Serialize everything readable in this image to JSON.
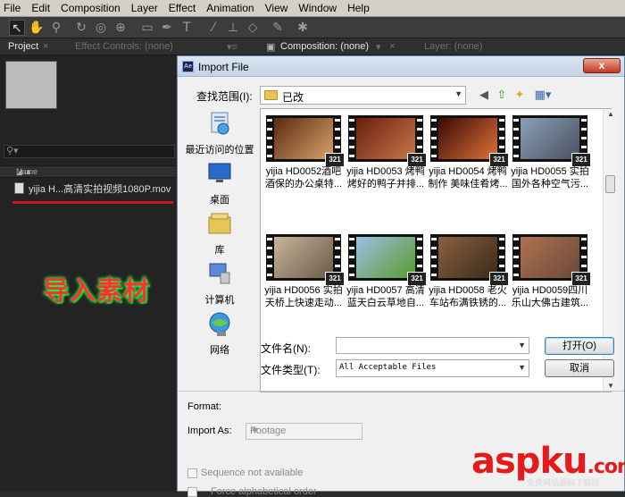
{
  "menubar": [
    "File",
    "Edit",
    "Composition",
    "Layer",
    "Effect",
    "Animation",
    "View",
    "Window",
    "Help"
  ],
  "panels": {
    "project_tab": "Project",
    "effect_controls_tab": "Effect Controls: (none)",
    "composition_tab": "Composition: (none)",
    "layer_tab": "Layer: (none)"
  },
  "project": {
    "search_placeholder": "",
    "column_name": "Name",
    "items": [
      {
        "name": "yijia H...高清实拍视频1080P.mov"
      }
    ]
  },
  "annotation": "导入素材",
  "dialog": {
    "title": "Import File",
    "close_label": "x",
    "look_in_label": "查找范围(I):",
    "look_in_value": "已改",
    "places": [
      {
        "label": "最近访问的位置",
        "icon": "recent-places-icon"
      },
      {
        "label": "桌面",
        "icon": "desktop-icon"
      },
      {
        "label": "库",
        "icon": "libraries-icon"
      },
      {
        "label": "计算机",
        "icon": "computer-icon"
      },
      {
        "label": "网络",
        "icon": "network-icon"
      }
    ],
    "files": [
      {
        "caption": "yijia HD0052酒吧酒保的办公桌特...",
        "badge": "321",
        "colors": [
          "#5a2a10",
          "#d9a36a"
        ]
      },
      {
        "caption": "yijia HD0053 烤鸭烤好的鸭子并排...",
        "badge": "321",
        "colors": [
          "#6a1e0e",
          "#c8784a"
        ]
      },
      {
        "caption": "yijia HD0054 烤鸭制作 美味佳肴烤...",
        "badge": "321",
        "colors": [
          "#3a0a04",
          "#e0703a"
        ]
      },
      {
        "caption": "yijia HD0055 实拍国外各种空气污...",
        "badge": "321",
        "colors": [
          "#8aa0b8",
          "#4a5060"
        ]
      },
      {
        "caption": "yijia HD0056 实拍天桥上快速走动...",
        "badge": "321",
        "colors": [
          "#c8b49a",
          "#6a5a48"
        ]
      },
      {
        "caption": "yijia HD0057 高清蓝天白云草地自...",
        "badge": "321",
        "colors": [
          "#9ac0e8",
          "#5a9a2a"
        ]
      },
      {
        "caption": "yijia HD0058 老火车站布满铁锈的...",
        "badge": "321",
        "colors": [
          "#8a6040",
          "#3a2a1a"
        ]
      },
      {
        "caption": "yijia HD0059四川乐山大佛古建筑...",
        "badge": "321",
        "colors": [
          "#b07050",
          "#6a4a3a"
        ]
      }
    ],
    "file_name_label": "文件名(N):",
    "file_name_value": "",
    "file_type_label": "文件类型(T):",
    "file_type_value": "All Acceptable Files",
    "open_button": "打开(O)",
    "cancel_button": "取消",
    "format_label": "Format:",
    "import_as_label": "Import As:",
    "import_as_value": "Footage",
    "sequence_label": "Sequence not available",
    "force_alpha_label": "Force alphabetical order"
  },
  "watermark": {
    "asp": "asp",
    "ku": "ku",
    "com": ".com",
    "sub": "免费网站源码下载站"
  }
}
